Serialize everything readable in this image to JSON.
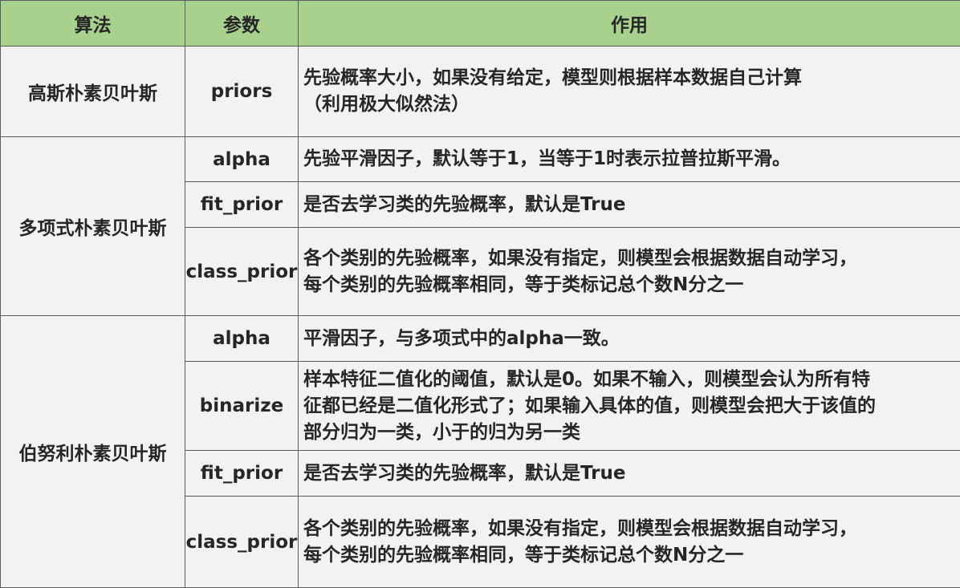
{
  "header": {
    "col_algorithm": "算法",
    "col_param": "参数",
    "col_effect": "作用"
  },
  "rows": {
    "gaussian": {
      "name": "高斯朴素贝叶斯",
      "params": [
        {
          "param": "priors",
          "lines": [
            "先验概率大小，如果没有给定，模型则根据样本数据自己计算",
            "（利用极大似然法）"
          ]
        }
      ]
    },
    "multinomial": {
      "name": "多项式朴素贝叶斯",
      "params": [
        {
          "param": "alpha",
          "lines": [
            "先验平滑因子，默认等于1，当等于1时表示拉普拉斯平滑。"
          ]
        },
        {
          "param": "fit_prior",
          "lines": [
            "是否去学习类的先验概率，默认是True"
          ]
        },
        {
          "param": "class_prior",
          "lines": [
            "各个类别的先验概率，如果没有指定，则模型会根据数据自动学习，",
            "每个类别的先验概率相同，等于类标记总个数N分之一"
          ]
        }
      ]
    },
    "bernoulli": {
      "name": "伯努利朴素贝叶斯",
      "params": [
        {
          "param": "alpha",
          "lines": [
            "平滑因子，与多项式中的alpha一致。"
          ]
        },
        {
          "param": "binarize",
          "lines": [
            "样本特征二值化的阈值，默认是0。如果不输入，则模型会认为所有特",
            "征都已经是二值化形式了；如果输入具体的值，则模型会把大于该值的",
            "部分归为一类，小于的归为另一类"
          ]
        },
        {
          "param": "fit_prior",
          "lines": [
            "是否去学习类的先验概率，默认是True"
          ]
        },
        {
          "param": "class_prior",
          "lines": [
            "各个类别的先验概率，如果没有指定，则模型会根据数据自动学习，",
            "每个类别的先验概率相同，等于类标记总个数N分之一"
          ]
        }
      ]
    }
  }
}
